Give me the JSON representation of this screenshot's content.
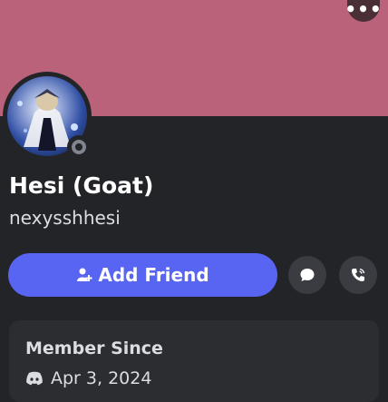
{
  "profile": {
    "display_name": "Hesi (Goat)",
    "username": "nexysshhesi",
    "status": "offline"
  },
  "actions": {
    "more_label": "•••",
    "add_friend_label": "Add Friend"
  },
  "member_since": {
    "title": "Member Since",
    "date": "Apr 3, 2024"
  },
  "colors": {
    "banner": "#b9627a",
    "accent": "#5865f2",
    "background": "#232428"
  },
  "icons": {
    "more": "more-icon",
    "add_friend": "add-friend-icon",
    "message": "message-icon",
    "call": "phone-icon",
    "discord": "discord-icon"
  }
}
